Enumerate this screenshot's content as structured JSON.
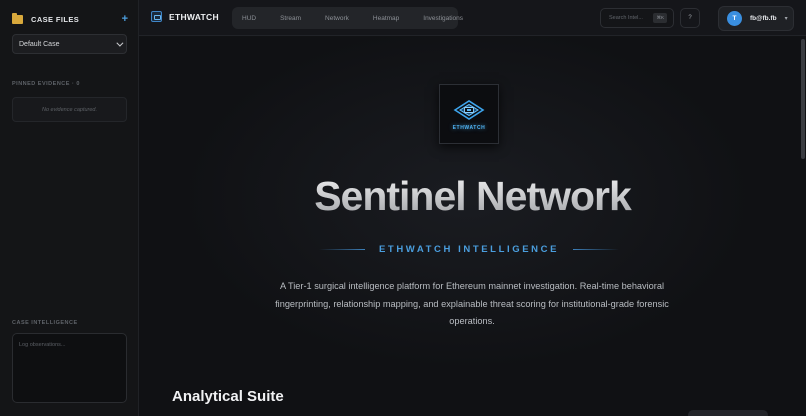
{
  "sidebar": {
    "case_files_title": "CASE FILES",
    "add_label": "+",
    "case_select_value": "Default Case",
    "pinned_label": "PINNED EVIDENCE · 0",
    "no_evidence": "No evidence captured.",
    "case_intel_label": "CASE INTELLIGENCE",
    "notes_placeholder": "Log observations...",
    "collapse_glyph": "‹"
  },
  "topbar": {
    "brand": "ETHWATCH",
    "nav": [
      "HUD",
      "Stream",
      "Network",
      "Heatmap",
      "Investigations"
    ],
    "search_placeholder": "Search Intel...",
    "search_shortcut": "⌘K",
    "help_label": "?",
    "avatar_initial": "T",
    "user_name": "fb@fb.fb",
    "user_caret": "▾"
  },
  "hero": {
    "logo_text": "ETHWATCH",
    "title": "Sentinel Network",
    "subtitle": "ETHWATCH INTELLIGENCE",
    "description": "A Tier-1 surgical intelligence platform for Ethereum mainnet investigation. Real-time behavioral fingerprinting, relationship mapping, and explainable threat scoring for institutional-grade forensic operations."
  },
  "suite": {
    "title": "Analytical Suite"
  },
  "colors": {
    "accent": "#4a9ede",
    "folder": "#d9a93c",
    "avatar": "#3a8fe0"
  }
}
